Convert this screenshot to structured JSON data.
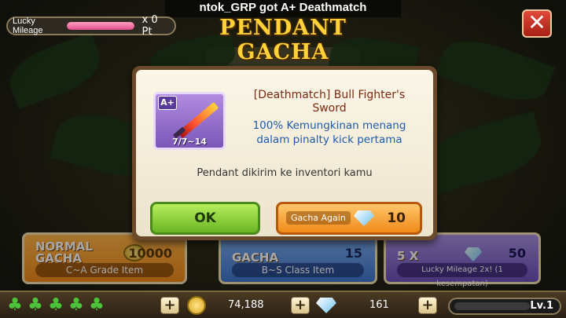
{
  "ticker_text": "ntok_GRP got A+ Deathmatch",
  "title": "PENDANT GACHA",
  "lucky_mileage": {
    "label": "Lucky Mileage",
    "value": "x 0 Pt",
    "progress": 1.0
  },
  "close_icon": "close-icon",
  "cards": {
    "normal": {
      "head": "NORMAL\nGACHA",
      "sub": "C~A Grade Item",
      "price": "10000"
    },
    "premium": {
      "head": "GACHA",
      "sub": "B~S Class Item",
      "price": "15"
    },
    "mileage": {
      "head": "5 X",
      "sub": "Lucky Mileage 2x! (1 kesempatan)",
      "price": "50"
    }
  },
  "modal": {
    "item_grade": "A+",
    "item_stat": "7/7~14",
    "item_name": "[Deathmatch] Bull Fighter's Sword",
    "item_desc": "100% Kemungkinan menang dalam pinalty kick pertama",
    "notice": "Pendant dikirim ke inventori kamu",
    "ok_label": "OK",
    "again_label": "Gacha Again",
    "again_cost": "10"
  },
  "bottom": {
    "clover_count": 5,
    "coins": "74,188",
    "gems": "161",
    "level": "Lv.1"
  },
  "colors": {
    "accent_gold": "#ffd23a",
    "ok_green": "#6ab524",
    "again_orange": "#f08a1a",
    "close_red": "#c0301f"
  }
}
